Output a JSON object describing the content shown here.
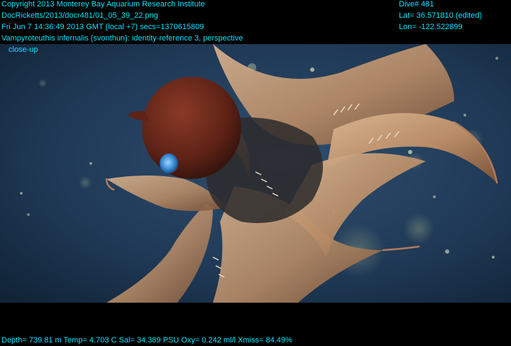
{
  "overlay": {
    "copyright": "Copyright 2013 Monterey Bay Aquarium Research Institute",
    "file_path": "DocRicketts/2013/docr481/01_05_39_22.png",
    "timestamp": "Fri Jun  7 14:36:49 2013 GMT (local +7)  secs=1370615809",
    "species_line": "Vampyroteuthis infernalis (svonthun): identity-reference 3, perspective",
    "species_line_cont": "close-up",
    "dive": "Dive# 481",
    "latitude": "Lat= 36.571810 (edited)",
    "longitude": "Lon= -122.522899",
    "sensors": "Depth= 739.81 m  Temp= 4.703 C  Sal= 34.389 PSU  Oxy= 0.242 ml/l  Xmiss= 84.49%"
  },
  "colors": {
    "overlay_text": "#00e5ff",
    "water": "#1e3550",
    "mantle": "#6e2a1a",
    "web": "#c9a27a",
    "eye": "#3a8fd6"
  }
}
